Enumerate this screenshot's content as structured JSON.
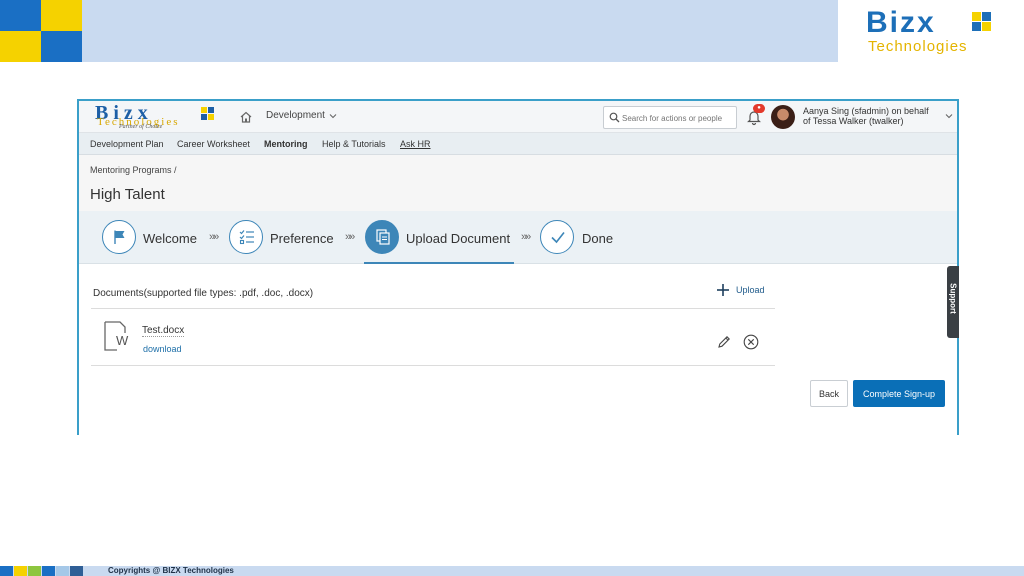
{
  "slide": {
    "logo_name": "Bizx",
    "logo_tagline": "Technologies",
    "footer": "Copyrights @ BIZX Technologies",
    "colors": {
      "brand_blue": "#1a6fc4",
      "brand_yellow": "#f5d200",
      "header_band": "#c9daf0"
    }
  },
  "app": {
    "logo": {
      "name": "Bizx",
      "tagline": "Technologies",
      "partner": "Partner of Choice"
    },
    "module": "Development",
    "search": {
      "placeholder": "Search for actions or people"
    },
    "user": {
      "line1": "Aanya Sing (sfadmin) on behalf",
      "line2": "of Tessa Walker (twalker)"
    },
    "menu": [
      {
        "label": "Development Plan"
      },
      {
        "label": "Career Worksheet"
      },
      {
        "label": "Mentoring"
      },
      {
        "label": "Help & Tutorials"
      },
      {
        "label": "Ask HR"
      }
    ],
    "breadcrumb": "Mentoring Programs /",
    "title": "High Talent",
    "steps": [
      {
        "label": "Welcome",
        "icon": "flag-icon"
      },
      {
        "label": "Preference",
        "icon": "checklist-icon"
      },
      {
        "label": "Upload Document",
        "icon": "document-icon"
      },
      {
        "label": "Done",
        "icon": "check-icon"
      }
    ],
    "separator": "»»",
    "documents": {
      "header": "Documents(supported file types: .pdf, .doc, .docx)",
      "upload_label": "Upload",
      "files": [
        {
          "name": "Test.docx",
          "action": "download"
        }
      ]
    },
    "buttons": {
      "back": "Back",
      "complete": "Complete Sign-up"
    },
    "support": "Support",
    "accent": "#0a6fb7"
  }
}
